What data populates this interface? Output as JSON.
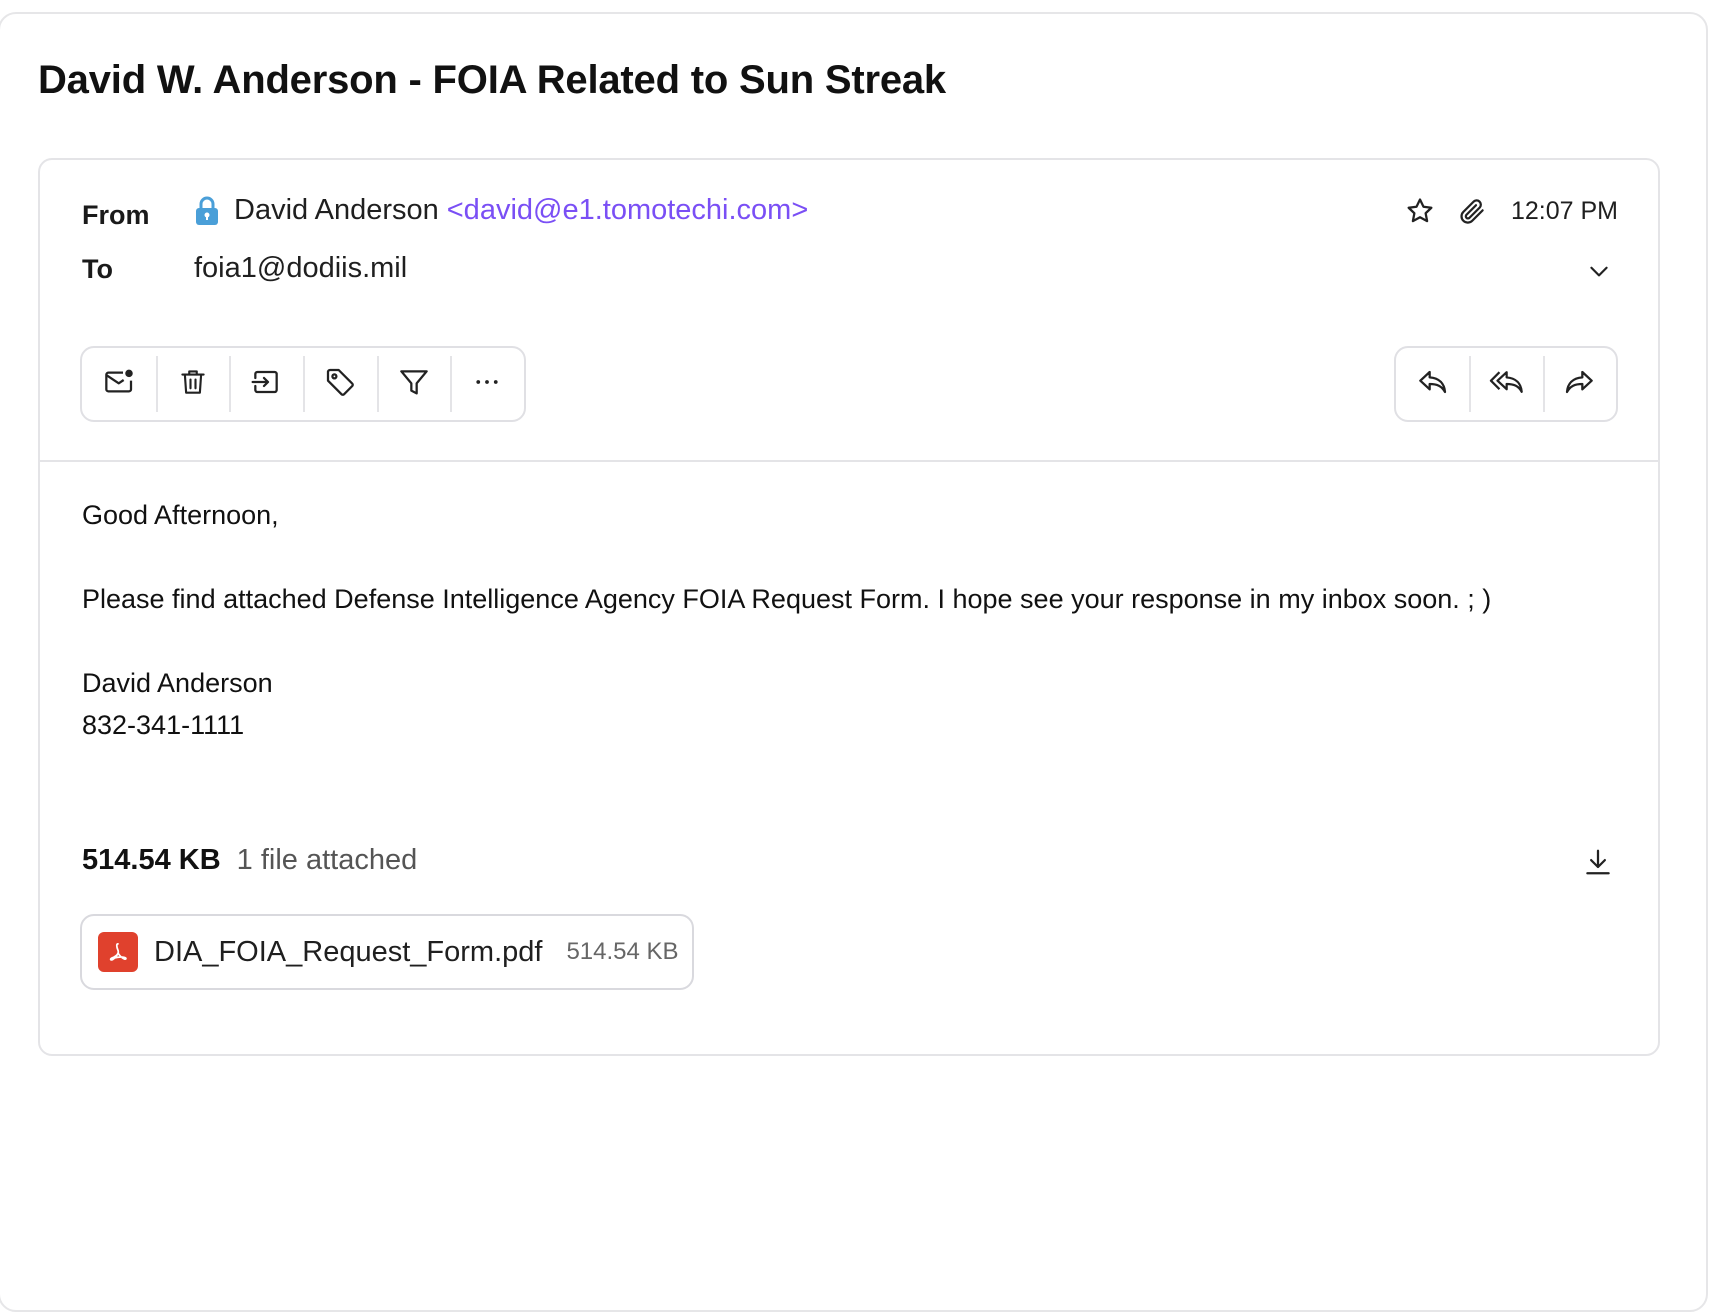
{
  "email": {
    "subject": "David W. Anderson - FOIA Related to Sun Streak",
    "from_label": "From",
    "to_label": "To",
    "sender_name": "David Anderson",
    "sender_email": "<david@e1.tomotechi.com>",
    "recipient": "foia1@dodiis.mil",
    "time": "12:07 PM",
    "body": {
      "greeting": "Good Afternoon,",
      "paragraph": "Please find attached Defense Intelligence Agency FOIA Request Form. I hope see your response in my inbox soon. ; )",
      "signature_name": "David Anderson",
      "signature_phone": "832-341-1111"
    },
    "attachments": {
      "total_size": "514.54 KB",
      "count_text": "1 file attached",
      "files": [
        {
          "name": "DIA_FOIA_Request_Form.pdf",
          "size": "514.54 KB",
          "icon": "pdf-icon"
        }
      ]
    }
  },
  "toolbar": {
    "left_actions": [
      "mark-unread-icon",
      "trash-icon",
      "move-icon",
      "tag-icon",
      "filter-icon",
      "more-icon"
    ],
    "right_actions": [
      "reply-icon",
      "reply-all-icon",
      "forward-icon"
    ]
  },
  "icons": {
    "lock": "lock-icon",
    "star": "star-icon",
    "attachment": "paperclip-icon",
    "expand": "chevron-down-icon",
    "download": "download-icon"
  },
  "colors": {
    "sender_email": "#7a4ff5",
    "lock": "#4a9fd8",
    "pdf": "#e0412d"
  }
}
